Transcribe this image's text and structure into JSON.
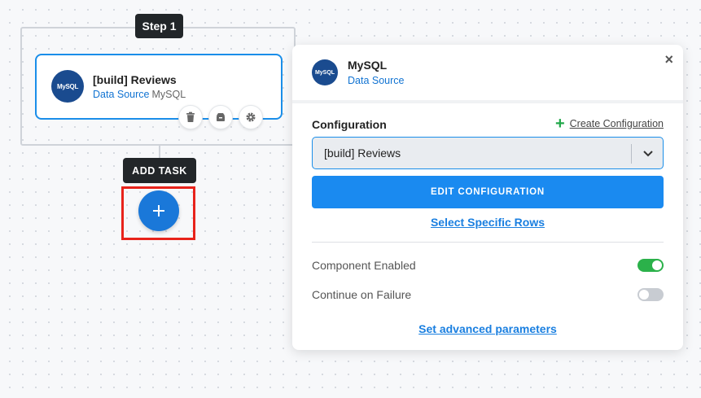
{
  "canvas": {
    "step_label": "Step 1",
    "add_task_label": "ADD TASK",
    "add_button_icon": "plus-icon",
    "task": {
      "name": "[build] Reviews",
      "type": "Data Source",
      "component": "MySQL",
      "logo_text": "MySQL",
      "actions": [
        "trash-icon",
        "archive-icon",
        "gear-icon"
      ]
    }
  },
  "panel": {
    "logo_text": "MySQL",
    "title": "MySQL",
    "subtitle": "Data Source",
    "close_icon": "×",
    "configuration_label": "Configuration",
    "create_configuration": "Create Configuration",
    "selected_configuration": "[build] Reviews",
    "edit_button": "EDIT CONFIGURATION",
    "select_rows_link": "Select Specific Rows",
    "component_enabled_label": "Component Enabled",
    "component_enabled": true,
    "continue_on_failure_label": "Continue on Failure",
    "continue_on_failure": false,
    "advanced_link": "Set advanced parameters"
  },
  "colors": {
    "accent": "#1a8af0",
    "toggle_on": "#2bb14a",
    "highlight": "#e8231b"
  }
}
